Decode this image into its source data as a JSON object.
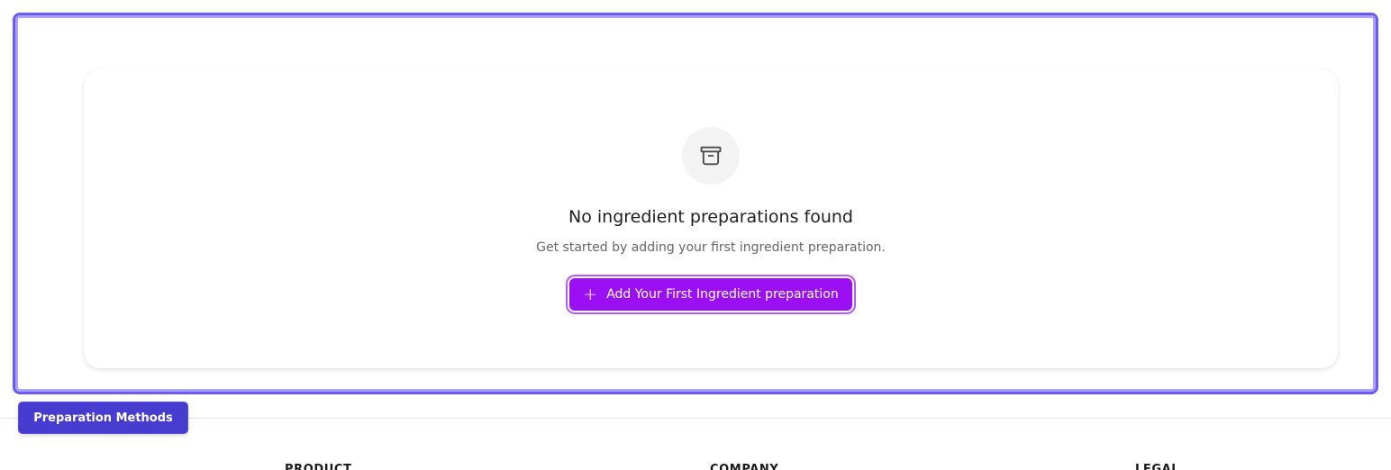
{
  "empty_state": {
    "icon": "archive-box-icon",
    "title": "No ingredient preparations found",
    "subtitle": "Get started by adding your first ingredient preparation.",
    "button_label": "Add Your First Ingredient preparation"
  },
  "badge": {
    "label": "Preparation Methods"
  },
  "footer": {
    "columns": [
      "PRODUCT",
      "COMPANY",
      "LEGAL"
    ]
  },
  "colors": {
    "highlight_border": "#6b5cf0",
    "primary_button": "#9b10f2",
    "badge": "#463ccf"
  }
}
